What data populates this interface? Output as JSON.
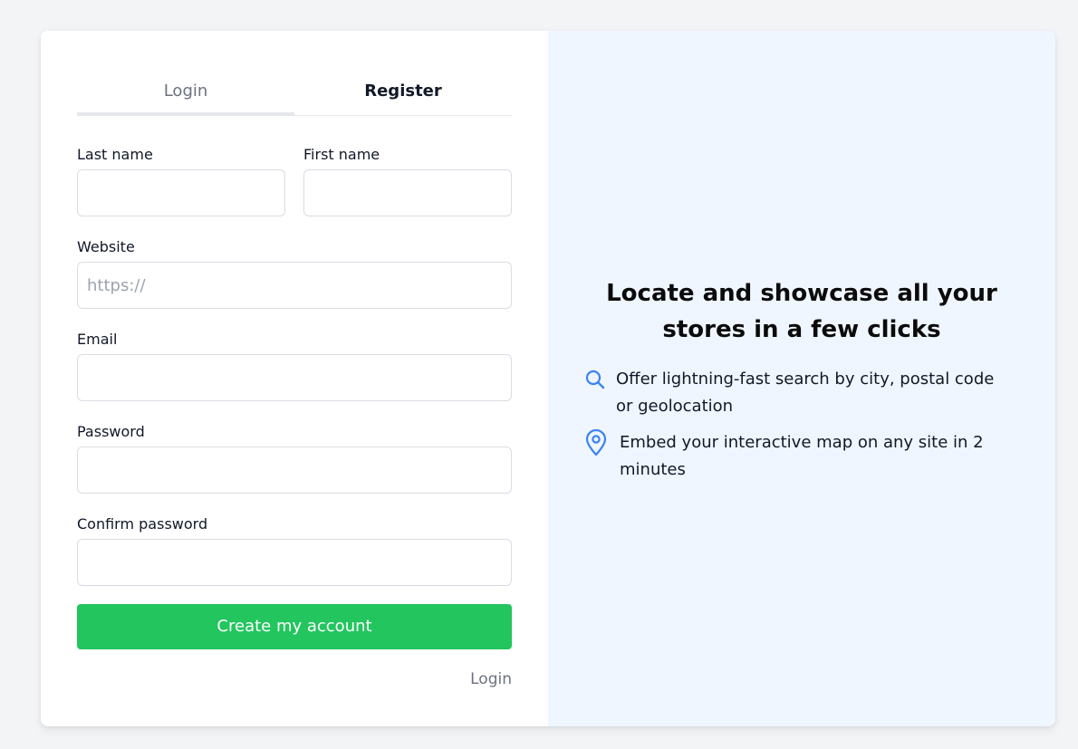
{
  "tabs": [
    {
      "label": "Login",
      "active": false
    },
    {
      "label": "Register",
      "active": true
    }
  ],
  "form": {
    "last_name": {
      "label": "Last name",
      "value": "",
      "placeholder": ""
    },
    "first_name": {
      "label": "First name",
      "value": "",
      "placeholder": ""
    },
    "website": {
      "label": "Website",
      "value": "",
      "placeholder": "https://"
    },
    "email": {
      "label": "Email",
      "value": "",
      "placeholder": ""
    },
    "password": {
      "label": "Password",
      "value": "",
      "placeholder": ""
    },
    "confirm_password": {
      "label": "Confirm password",
      "value": "",
      "placeholder": ""
    },
    "submit_label": "Create my account",
    "login_link": "Login"
  },
  "promo": {
    "headline": "Locate and showcase all your stores in a few clicks",
    "features": [
      {
        "icon": "search-icon",
        "text": "Offer lightning-fast search by city, postal code or geolocation"
      },
      {
        "icon": "map-pin-icon",
        "text": "Embed your interactive map on any site in 2 minutes"
      }
    ]
  },
  "colors": {
    "accent": "#22c55e",
    "icon": "#3b82f6",
    "panel": "#eff6ff",
    "background": "#f3f4f6"
  }
}
